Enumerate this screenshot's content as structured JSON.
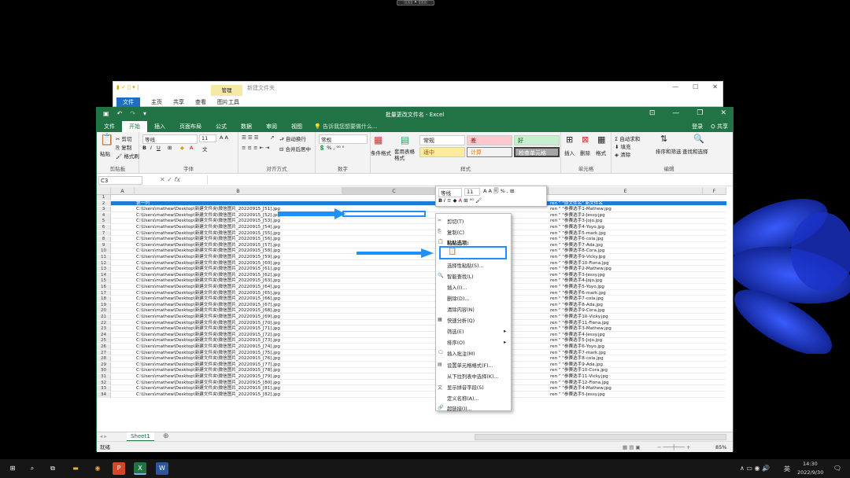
{
  "handle": "▯▯▯▯ ✦ ▯▯▯▯",
  "explorer": {
    "manage": "管理",
    "title": "新建文件夹",
    "tabs": [
      "文件",
      "主页",
      "共享",
      "查看",
      "图片工具"
    ],
    "win": [
      "—",
      "☐",
      "✕"
    ]
  },
  "excel": {
    "title": "批量更改文件名 - Excel",
    "tabs": [
      "文件",
      "开始",
      "插入",
      "页面布局",
      "公式",
      "数据",
      "审阅",
      "视图"
    ],
    "tell": "告诉我您想要做什么...",
    "login": "登录",
    "share": "共享",
    "ribbon": {
      "paste": "粘贴",
      "cut": "剪切",
      "copy": "复制",
      "painter": "格式刷",
      "clipboard": "剪贴板",
      "font_name": "等线",
      "font_size": "11",
      "font": "字体",
      "wrap": "自动换行",
      "merge": "合并后居中",
      "align": "对齐方式",
      "num_fmt": "常规",
      "number": "数字",
      "cond": "条件格式",
      "table_fmt": "套用表格格式",
      "s_normal": "常规",
      "s_bad": "差",
      "s_good": "好",
      "s_neutral": "适中",
      "s_calc": "计算",
      "s_check": "检查单元格",
      "styles": "样式",
      "insert": "插入",
      "delete": "删除",
      "format": "格式",
      "cells": "单元格",
      "autosum": "自动求和",
      "fill": "填充",
      "clear": "清除",
      "sort": "排序和筛选",
      "find": "查找和选择",
      "edit": "编辑"
    },
    "namebox": "C3",
    "cols": [
      "A",
      "B",
      "C",
      "D",
      "E",
      "F"
    ],
    "header_row": {
      "b": "第一列",
      "c": "原文件名",
      "e": "ren \" \"原文件名\" 新文件名"
    },
    "rows": [
      {
        "n": "1",
        "b": "",
        "c": "",
        "e": ""
      },
      {
        "n": "2",
        "b": "第一列",
        "c": "原文件名",
        "e": "ren \" \"原文件名\" 新文件名"
      },
      {
        "n": "3",
        "b": "C:\\Users\\mathew\\Desktop\\新建文件夹\\微信图片_20220915_[51].jpg",
        "c": "",
        "e": "ren \" \"参赛选手1-Mathew.jpg"
      },
      {
        "n": "4",
        "b": "C:\\Users\\mathew\\Desktop\\新建文件夹\\微信图片_20220915_[52].jpg",
        "c": "",
        "e": "ren \" \"参赛选手2-Jessy.jpg"
      },
      {
        "n": "5",
        "b": "C:\\Users\\mathew\\Desktop\\新建文件夹\\微信图片_20220915_[53].jpg",
        "c": "",
        "e": "ren \" \"参赛选手3-Jojo.jpg"
      },
      {
        "n": "6",
        "b": "C:\\Users\\mathew\\Desktop\\新建文件夹\\微信图片_20220915_[54].jpg",
        "c": "",
        "e": "ren \" \"参赛选手4-Yoyo.jpg"
      },
      {
        "n": "7",
        "b": "C:\\Users\\mathew\\Desktop\\新建文件夹\\微信图片_20220915_[55].jpg",
        "c": "",
        "e": "ren \" \"参赛选手5-mark.jpg"
      },
      {
        "n": "8",
        "b": "C:\\Users\\mathew\\Desktop\\新建文件夹\\微信图片_20220915_[56].jpg",
        "c": "",
        "e": "ren \" \"参赛选手6-cola.jpg"
      },
      {
        "n": "9",
        "b": "C:\\Users\\mathew\\Desktop\\新建文件夹\\微信图片_20220915_[57].jpg",
        "c": "",
        "e": "ren \" \"参赛选手7-Ada.jpg"
      },
      {
        "n": "10",
        "b": "C:\\Users\\mathew\\Desktop\\新建文件夹\\微信图片_20220915_[58].jpg",
        "c": "",
        "e": "ren \" \"参赛选手8-Cora.jpg"
      },
      {
        "n": "11",
        "b": "C:\\Users\\mathew\\Desktop\\新建文件夹\\微信图片_20220915_[59].jpg",
        "c": "",
        "e": "ren \" \"参赛选手9-Vicky.jpg"
      },
      {
        "n": "12",
        "b": "C:\\Users\\mathew\\Desktop\\新建文件夹\\微信图片_20220915_[60].jpg",
        "c": "",
        "e": "ren \" \"参赛选手10-Fiona.jpg"
      },
      {
        "n": "13",
        "b": "C:\\Users\\mathew\\Desktop\\新建文件夹\\微信图片_20220915_[61].jpg",
        "c": "",
        "e": "ren \" \"参赛选手2-Mathew.jpg"
      },
      {
        "n": "14",
        "b": "C:\\Users\\mathew\\Desktop\\新建文件夹\\微信图片_20220915_[62].jpg",
        "c": "",
        "e": "ren \" \"参赛选手3-Jessy.jpg"
      },
      {
        "n": "15",
        "b": "C:\\Users\\mathew\\Desktop\\新建文件夹\\微信图片_20220915_[63].jpg",
        "c": "",
        "e": "ren \" \"参赛选手4-Jojo.jpg"
      },
      {
        "n": "16",
        "b": "C:\\Users\\mathew\\Desktop\\新建文件夹\\微信图片_20220915_[64].jpg",
        "c": "",
        "e": "ren \" \"参赛选手5-Yoyo.jpg"
      },
      {
        "n": "17",
        "b": "C:\\Users\\mathew\\Desktop\\新建文件夹\\微信图片_20220915_[65].jpg",
        "c": "",
        "e": "ren \" \"参赛选手6-mark.jpg"
      },
      {
        "n": "18",
        "b": "C:\\Users\\mathew\\Desktop\\新建文件夹\\微信图片_20220915_[66].jpg",
        "c": "",
        "e": "ren \" \"参赛选手7-cola.jpg"
      },
      {
        "n": "19",
        "b": "C:\\Users\\mathew\\Desktop\\新建文件夹\\微信图片_20220915_[67].jpg",
        "c": "",
        "e": "ren \" \"参赛选手8-Ada.jpg"
      },
      {
        "n": "20",
        "b": "C:\\Users\\mathew\\Desktop\\新建文件夹\\微信图片_20220915_[68].jpg",
        "c": "",
        "e": "ren \" \"参赛选手9-Cora.jpg"
      },
      {
        "n": "21",
        "b": "C:\\Users\\mathew\\Desktop\\新建文件夹\\微信图片_20220915_[69].jpg",
        "c": "",
        "e": "ren \" \"参赛选手10-Vicky.jpg"
      },
      {
        "n": "22",
        "b": "C:\\Users\\mathew\\Desktop\\新建文件夹\\微信图片_20220915_[70].jpg",
        "c": "",
        "e": "ren \" \"参赛选手11-Fiona.jpg"
      },
      {
        "n": "23",
        "b": "C:\\Users\\mathew\\Desktop\\新建文件夹\\微信图片_20220915_[71].jpg",
        "c": "",
        "e": "ren \" \"参赛选手3-Mathew.jpg"
      },
      {
        "n": "24",
        "b": "C:\\Users\\mathew\\Desktop\\新建文件夹\\微信图片_20220915_[72].jpg",
        "c": "",
        "e": "ren \" \"参赛选手4-Jessy.jpg"
      },
      {
        "n": "25",
        "b": "C:\\Users\\mathew\\Desktop\\新建文件夹\\微信图片_20220915_[73].jpg",
        "c": "",
        "e": "ren \" \"参赛选手5-Jojo.jpg"
      },
      {
        "n": "26",
        "b": "C:\\Users\\mathew\\Desktop\\新建文件夹\\微信图片_20220915_[74].jpg",
        "c": "",
        "e": "ren \" \"参赛选手6-Yoyo.jpg"
      },
      {
        "n": "27",
        "b": "C:\\Users\\mathew\\Desktop\\新建文件夹\\微信图片_20220915_[75].jpg",
        "c": "",
        "e": "ren \" \"参赛选手7-mark.jpg"
      },
      {
        "n": "28",
        "b": "C:\\Users\\mathew\\Desktop\\新建文件夹\\微信图片_20220915_[76].jpg",
        "c": "",
        "e": "ren \" \"参赛选手8-cola.jpg"
      },
      {
        "n": "29",
        "b": "C:\\Users\\mathew\\Desktop\\新建文件夹\\微信图片_20220915_[77].jpg",
        "c": "",
        "e": "ren \" \"参赛选手9-Ada.jpg"
      },
      {
        "n": "30",
        "b": "C:\\Users\\mathew\\Desktop\\新建文件夹\\微信图片_20220915_[78].jpg",
        "c": "",
        "e": "ren \" \"参赛选手10-Cora.jpg"
      },
      {
        "n": "31",
        "b": "C:\\Users\\mathew\\Desktop\\新建文件夹\\微信图片_20220915_[79].jpg",
        "c": "",
        "e": "ren \" \"参赛选手11-Vicky.jpg"
      },
      {
        "n": "32",
        "b": "C:\\Users\\mathew\\Desktop\\新建文件夹\\微信图片_20220915_[80].jpg",
        "c": "参赛选手12-Fiona.jpg",
        "e": "ren \" \"参赛选手12-Fiona.jpg"
      },
      {
        "n": "33",
        "b": "C:\\Users\\mathew\\Desktop\\新建文件夹\\微信图片_20220915_[81].jpg",
        "c": "参赛选手4-Mathew.jpg",
        "e": "ren \" \"参赛选手4-Mathew.jpg"
      },
      {
        "n": "34",
        "b": "C:\\Users\\mathew\\Desktop\\新建文件夹\\微信图片_20220915_[82].jpg",
        "c": "参赛选手5-Jessy.jpg",
        "e": "ren \" \"参赛选手5-Jessy.jpg"
      }
    ],
    "sheet": "Sheet1",
    "status_left": "就绪",
    "zoom": "85%"
  },
  "mini": {
    "font": "等线",
    "size": "11"
  },
  "menu": [
    "剪切(T)",
    "复制(C)",
    "粘贴选项:",
    "选择性粘贴(S)...",
    "智能查找(L)",
    "插入(I)...",
    "删除(D)...",
    "清除内容(N)",
    "快速分析(Q)",
    "筛选(E)",
    "排序(O)",
    "插入批注(M)",
    "设置单元格格式(F)...",
    "从下拉列表中选择(K)...",
    "显示拼音字段(S)",
    "定义名称(A)...",
    "超链接(I)..."
  ],
  "taskbar": {
    "time": "14:30",
    "date": "2022/9/30",
    "ime": "英"
  },
  "colors": {
    "excel_green": "#217346",
    "arrow_blue": "#1e90ff"
  }
}
